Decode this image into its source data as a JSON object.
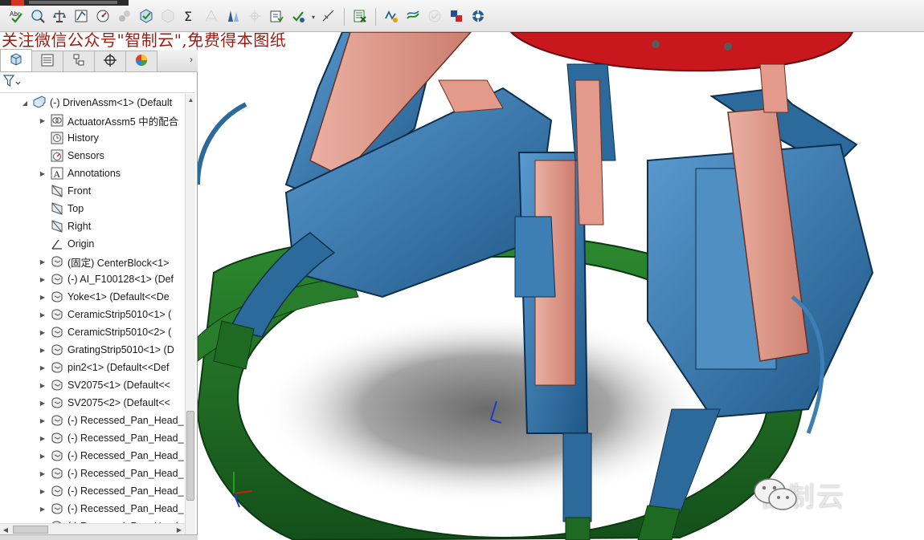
{
  "toolbar": {
    "tools": [
      {
        "icon": "spelling-check-icon"
      },
      {
        "icon": "measure-icon"
      },
      {
        "icon": "mass-properties-icon"
      },
      {
        "icon": "section-properties-icon"
      },
      {
        "icon": "sensor-icon"
      },
      {
        "icon": "statistics-icon"
      },
      {
        "icon": "check-entity-icon"
      },
      {
        "icon": "geometry-analysis-icon",
        "disabled": true
      },
      {
        "icon": "equations-icon"
      },
      {
        "icon": "draft-analysis-icon",
        "disabled": true
      },
      {
        "icon": "undercut-analysis-icon"
      },
      {
        "icon": "parting-line-icon",
        "disabled": true
      },
      {
        "icon": "symmetry-check-icon"
      },
      {
        "icon": "compare-documents-icon"
      },
      {
        "icon": "check-active-document-icon"
      },
      {
        "icon": "excel-bom-icon"
      },
      {
        "icon": "simulation-xpress-icon"
      },
      {
        "icon": "floxpress-icon"
      },
      {
        "icon": "dfmxpress-icon",
        "disabled": true
      },
      {
        "icon": "driveworks-xpress-icon"
      },
      {
        "icon": "costing-icon"
      }
    ]
  },
  "watermark": {
    "caption": "关注微信公众号\"智制云\",免费得本图纸",
    "logo_text": "智制云"
  },
  "panel": {
    "tabs": [
      {
        "icon": "feature-manager-icon",
        "active": true
      },
      {
        "icon": "property-manager-icon"
      },
      {
        "icon": "configuration-manager-icon"
      },
      {
        "icon": "dimxpert-manager-icon"
      },
      {
        "icon": "display-manager-icon"
      }
    ]
  },
  "tree": {
    "items": [
      {
        "label": "(-) DrivenAssm<1> (Default",
        "icon": "assembly-icon",
        "exp": "open",
        "indent": 0
      },
      {
        "label": "ActuatorAssm5 中的配合",
        "icon": "mates-icon",
        "exp": "closed",
        "indent": 1
      },
      {
        "label": "History",
        "icon": "history-icon",
        "exp": "none",
        "indent": 1
      },
      {
        "label": "Sensors",
        "icon": "sensors-icon",
        "exp": "none",
        "indent": 1
      },
      {
        "label": "Annotations",
        "icon": "annotations-icon",
        "exp": "closed",
        "indent": 1
      },
      {
        "label": "Front",
        "icon": "plane-icon",
        "exp": "none",
        "indent": 1
      },
      {
        "label": "Top",
        "icon": "plane-icon",
        "exp": "none",
        "indent": 1
      },
      {
        "label": "Right",
        "icon": "plane-icon",
        "exp": "none",
        "indent": 1
      },
      {
        "label": "Origin",
        "icon": "origin-icon",
        "exp": "none",
        "indent": 1
      },
      {
        "label": "(固定) CenterBlock<1>",
        "icon": "part-icon",
        "exp": "closed",
        "indent": 1
      },
      {
        "label": "(-) AI_F100128<1> (Def",
        "icon": "part-icon",
        "exp": "closed",
        "indent": 1
      },
      {
        "label": "Yoke<1> (Default<<De",
        "icon": "part-icon",
        "exp": "closed",
        "indent": 1
      },
      {
        "label": "CeramicStrip5010<1> (",
        "icon": "part-icon",
        "exp": "closed",
        "indent": 1
      },
      {
        "label": "CeramicStrip5010<2> (",
        "icon": "part-icon",
        "exp": "closed",
        "indent": 1
      },
      {
        "label": "GratingStrip5010<1> (D",
        "icon": "part-icon",
        "exp": "closed",
        "indent": 1
      },
      {
        "label": "pin2<1> (Default<<Def",
        "icon": "part-icon",
        "exp": "closed",
        "indent": 1
      },
      {
        "label": "SV2075<1> (Default<<",
        "icon": "part-icon",
        "exp": "closed",
        "indent": 1
      },
      {
        "label": "SV2075<2> (Default<<",
        "icon": "part-icon",
        "exp": "closed",
        "indent": 1
      },
      {
        "label": "(-) Recessed_Pan_Head_",
        "icon": "part-icon",
        "exp": "closed",
        "indent": 1
      },
      {
        "label": "(-) Recessed_Pan_Head_",
        "icon": "part-icon",
        "exp": "closed",
        "indent": 1
      },
      {
        "label": "(-) Recessed_Pan_Head_",
        "icon": "part-icon",
        "exp": "closed",
        "indent": 1
      },
      {
        "label": "(-) Recessed_Pan_Head_",
        "icon": "part-icon",
        "exp": "closed",
        "indent": 1
      },
      {
        "label": "(-) Recessed_Pan_Head_",
        "icon": "part-icon",
        "exp": "closed",
        "indent": 1
      },
      {
        "label": "(-) Recessed_Pan_Head_",
        "icon": "part-icon",
        "exp": "closed",
        "indent": 1
      },
      {
        "label": "(-) Recessed_Pan_Head_",
        "icon": "part-icon",
        "exp": "closed",
        "indent": 1
      }
    ]
  },
  "colors": {
    "assembly_blue": "#2c6a9c",
    "assembly_light_blue": "#4f8fc2",
    "ceramic_pink": "#e49a8a",
    "base_ring_green": "#1f6a22",
    "top_ring_red": "#c8171d",
    "caption_red": "#9c1c12"
  }
}
